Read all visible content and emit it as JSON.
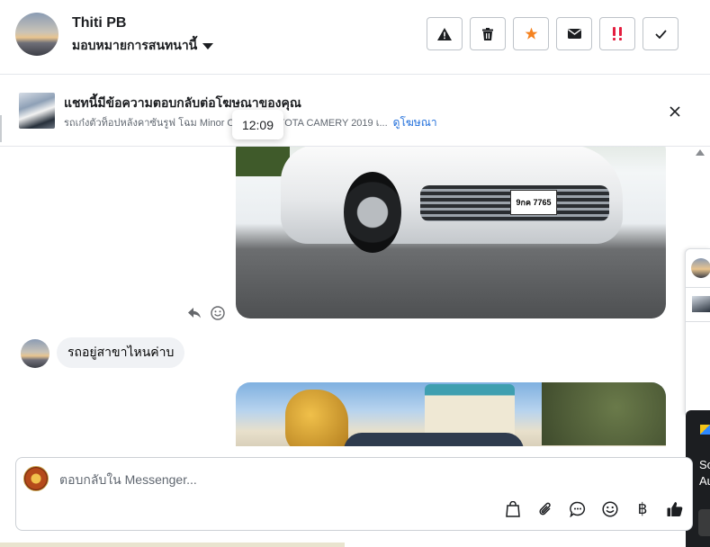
{
  "header": {
    "contact_name": "Thiti PB",
    "assign_label": "มอบหมายการสนทนานี้",
    "actions": [
      {
        "icon": "warning-icon",
        "label": "Report"
      },
      {
        "icon": "trash-icon",
        "label": "Delete"
      },
      {
        "icon": "star-icon",
        "label": "Star"
      },
      {
        "icon": "envelope-icon",
        "label": "Mark unread"
      },
      {
        "icon": "double-exclamation-icon",
        "label": "Follow up"
      },
      {
        "icon": "checkmark-icon",
        "label": "Done"
      }
    ]
  },
  "ad_banner": {
    "title": "แชทนี้มีข้อความตอบกลับต่อโฆษณาของคุณ",
    "subtitle": "รถเก๋งตัวท็อปหลังคาซันรูฟ โฉม Minor Change TOYOTA CAMERY 2019 เ...",
    "link": "ดูโฆษณา",
    "tooltip_time": "12:09"
  },
  "thread": {
    "photo_plate": "9กค 7765",
    "message_text": "รถอยู่สาขาไหนค่าบ"
  },
  "side_panel": {
    "dark_text_line1": "So",
    "dark_text_line2": "Au"
  },
  "composer": {
    "placeholder": "ตอบกลับใน Messenger...",
    "tools": [
      "bag-icon",
      "paperclip-icon",
      "chat-bubble-icon",
      "emoji-icon",
      "baht-icon",
      "thumbs-up-icon"
    ],
    "baht_symbol": "฿"
  },
  "colors": {
    "accent": "#216fdb",
    "star": "#f5821f",
    "follow_up": "#e41e3f",
    "bubble": "#f0f2f5"
  }
}
